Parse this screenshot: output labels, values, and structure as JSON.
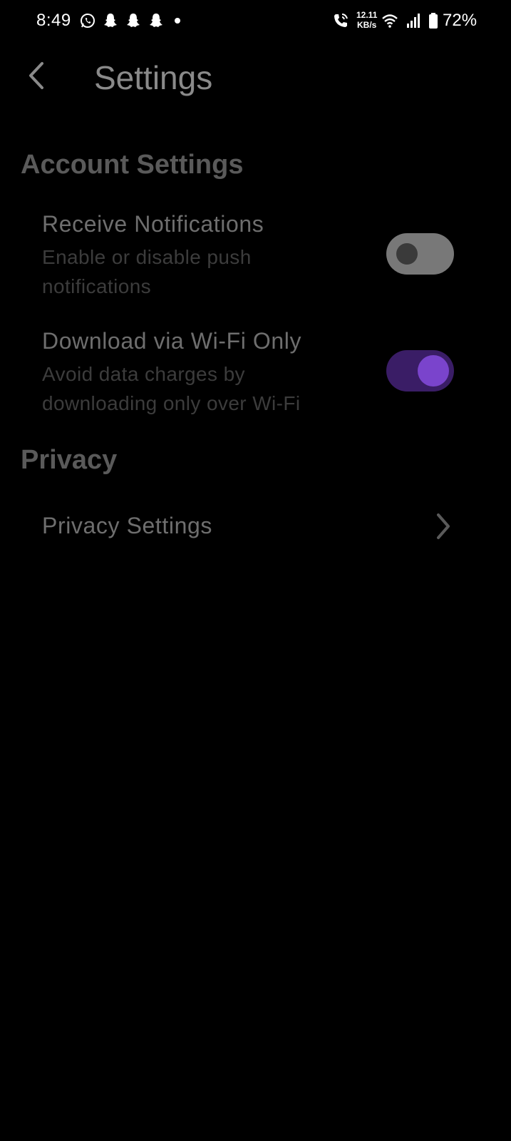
{
  "status_bar": {
    "time": "8:49",
    "net_speed_value": "12.11",
    "net_speed_unit": "KB/s",
    "battery_percent": "72%",
    "icons": [
      "whatsapp-icon",
      "snapchat-icon",
      "snapchat-icon",
      "snapchat-icon",
      "notification-dot",
      "wifi-call-icon",
      "wifi-icon",
      "signal-icon",
      "battery-icon"
    ]
  },
  "header": {
    "title": "Settings",
    "back_icon": "back-arrow-icon"
  },
  "sections": {
    "account": {
      "title": "Account Settings",
      "items": [
        {
          "title": "Receive Notifications",
          "subtitle": "Enable or disable push notifications",
          "toggle_on": false
        },
        {
          "title": "Download via Wi-Fi Only",
          "subtitle": "Avoid data charges by downloading only over Wi-Fi",
          "toggle_on": true
        }
      ]
    },
    "privacy": {
      "title": "Privacy",
      "items": [
        {
          "title": "Privacy Settings",
          "icon": "chevron-right-icon"
        }
      ]
    }
  },
  "colors": {
    "background": "#000000",
    "toggle_on_track": "#3a1d66",
    "toggle_on_knob": "#7a44cc",
    "toggle_off_track": "#787878"
  }
}
